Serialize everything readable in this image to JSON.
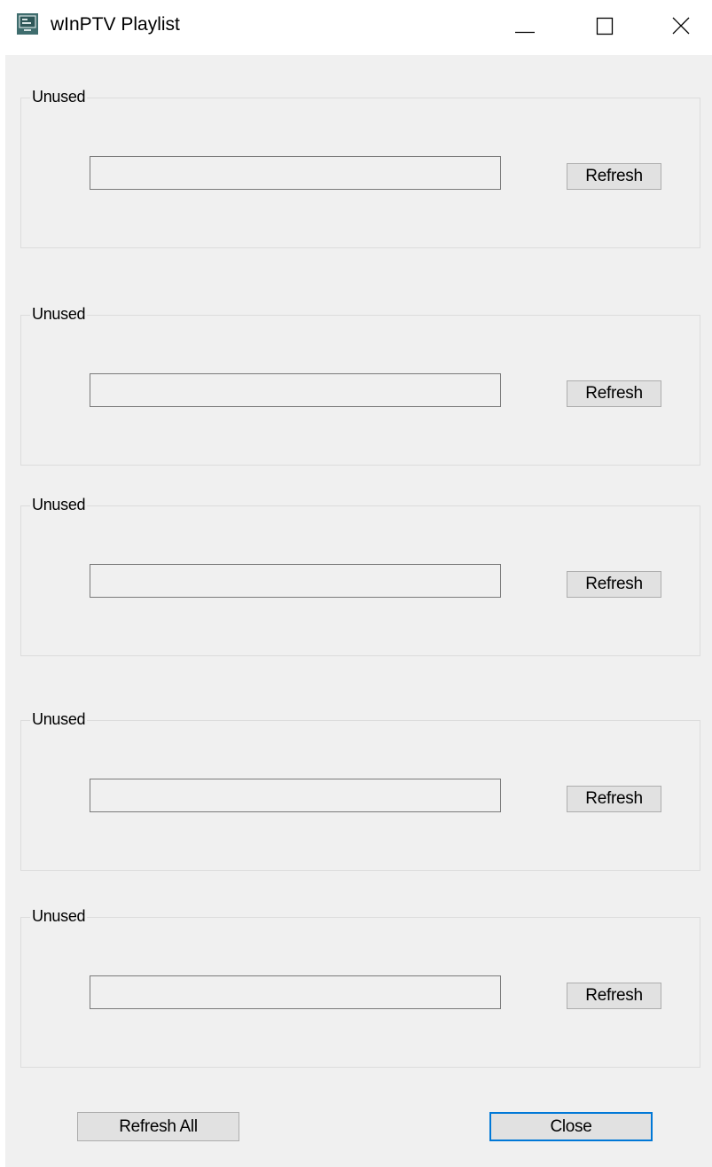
{
  "window": {
    "title": "wInPTV Playlist",
    "icon": "tv-playlist-icon",
    "controls": {
      "minimize_icon": "minimize-icon",
      "maximize_icon": "maximize-icon",
      "close_icon": "close-icon"
    }
  },
  "groups": [
    {
      "legend": "Unused",
      "input_value": "",
      "button_label": "Refresh"
    },
    {
      "legend": "Unused",
      "input_value": "",
      "button_label": "Refresh"
    },
    {
      "legend": "Unused",
      "input_value": "",
      "button_label": "Refresh"
    },
    {
      "legend": "Unused",
      "input_value": "",
      "button_label": "Refresh"
    },
    {
      "legend": "Unused",
      "input_value": "",
      "button_label": "Refresh"
    }
  ],
  "footer": {
    "refresh_all_label": "Refresh All",
    "close_label": "Close"
  },
  "colors": {
    "client_background": "#f0f0f0",
    "button_face": "#e1e1e1",
    "default_button_border": "#0078d7",
    "icon_teal": "#3f6d6e"
  }
}
